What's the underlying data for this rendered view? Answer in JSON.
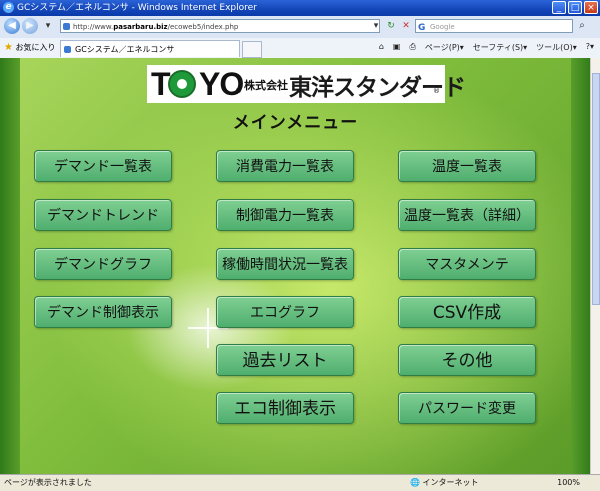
{
  "window": {
    "title": "GCシステム／エネルコンサ - Windows Internet Explorer"
  },
  "address": {
    "url_prefix": "http://www.",
    "url_host": "pasarbaru.biz",
    "url_path": "/ecoweb5/index.php"
  },
  "search": {
    "placeholder": "Google"
  },
  "favorites": {
    "label": "お気に入り",
    "tab_title": "GCシステム／エネルコンサ"
  },
  "tools": {
    "page": "ページ(P)▾",
    "safety": "セーフティ(S)▾",
    "tool": "ツール(O)▾",
    "help": "?▾"
  },
  "page": {
    "logo": {
      "to": "T",
      "yo": "YO",
      "kabushiki": "株式会社",
      "name": "東洋スタンダード",
      "reg": "®"
    },
    "title": "メインメニュー",
    "buttons": {
      "demand_list": "デマンド一覧表",
      "demand_trend": "デマンドトレンド",
      "demand_graph": "デマンドグラフ",
      "demand_control": "デマンド制御表示",
      "power_consumption": "消費電力一覧表",
      "control_power": "制御電力一覧表",
      "operating_time": "稼働時間状況一覧表",
      "eco_graph": "エコグラフ",
      "past_list": "過去リスト",
      "eco_control": "エコ制御表示",
      "temperature": "温度一覧表",
      "temperature_detail": "温度一覧表（詳細）",
      "master_maintenance": "マスタメンテ",
      "csv": "CSV作成",
      "other": "その他",
      "password": "パスワード変更"
    }
  },
  "status": {
    "text": "ページが表示されました",
    "zone": "インターネット",
    "zoom": "100%"
  }
}
